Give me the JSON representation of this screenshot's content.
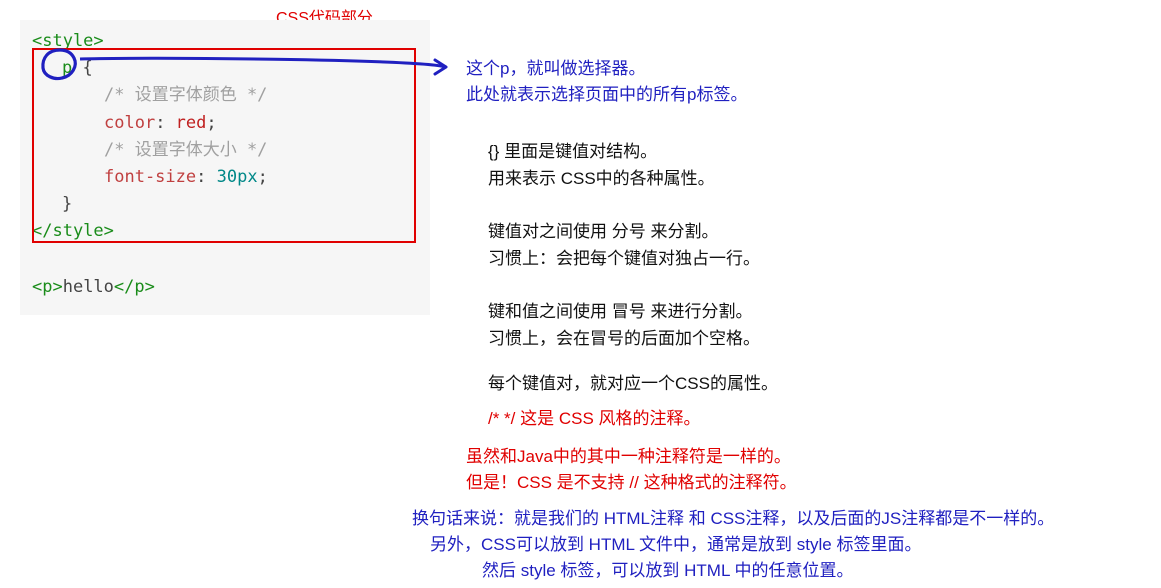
{
  "labels": {
    "css_section_title": "CSS代码部分"
  },
  "code": {
    "style_open": "<style>",
    "selector": "p",
    "brace_open": "{",
    "comment1": "/* 设置字体颜色 */",
    "prop1": "color",
    "val1": "red",
    "semi": ";",
    "comment2": "/* 设置字体大小 */",
    "prop2": "font-size",
    "val2": "30px",
    "brace_close": "}",
    "style_close": "</style>",
    "p_open": "<p>",
    "p_text": "hello",
    "p_close": "</p>"
  },
  "annotations": {
    "selector_note1": "这个p，就叫做选择器。",
    "selector_note2": "此处就表示选择页面中的所有p标签。",
    "braces_note1": "{} 里面是键值对结构。",
    "braces_note2": "用来表示 CSS中的各种属性。",
    "semi_note1": "键值对之间使用  分号  来分割。",
    "semi_note2": "习惯上：会把每个键值对独占一行。",
    "colon_note1": "键和值之间使用  冒号  来进行分割。",
    "colon_note2": "习惯上，会在冒号的后面加个空格。",
    "pair_note": "每个键值对，就对应一个CSS的属性。",
    "comment_style": "/* */ 这是 CSS 风格的注释。",
    "java_note1": "虽然和Java中的其中一种注释符是一样的。",
    "java_note2": "但是！CSS 是不支持 // 这种格式的注释符。",
    "summary1": "换句话来说：就是我们的 HTML注释 和 CSS注释，以及后面的JS注释都是不一样的。",
    "summary2": "另外，CSS可以放到 HTML 文件中，通常是放到 style 标签里面。",
    "summary3": "然后 style 标签，可以放到 HTML 中的任意位置。"
  },
  "colors": {
    "highlight_red": "#e00000",
    "annotation_blue": "#2020c0",
    "code_bg": "#f6f6f6"
  }
}
